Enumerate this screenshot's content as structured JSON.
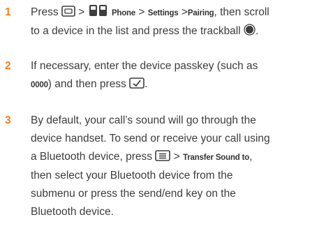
{
  "colors": {
    "step_number": "#f58220",
    "body_text": "#3d3d3d"
  },
  "icons": {
    "menu_key": "menu-key-icon",
    "phone_handset": "phone-handset-icon",
    "trackball": "trackball-icon",
    "soft_key": "soft-key-icon",
    "options_key": "options-key-icon"
  },
  "steps": [
    {
      "number": "1",
      "l1_press": "Press",
      "l1_sep1": ">",
      "l1_phone": "Phone",
      "l1_sep2": ">",
      "l1_settings": "Settings",
      "l1_sep3": ">",
      "l1_pairing": "Pairing",
      "l1_tail": ", then scroll",
      "l2_text": "to a device in the list and press the trackball",
      "l2_end": "."
    },
    {
      "number": "2",
      "l1_text": "If necessary, enter the device passkey (such as",
      "l2_code": "0000",
      "l2_text": ") and then press",
      "l2_end": "."
    },
    {
      "number": "3",
      "l1": "By default, your call’s sound will go through the",
      "l2": "device handset. To send or receive your call using",
      "l3_pre": "a Bluetooth device, press",
      "l3_sep": ">",
      "l3_transfer": "Transfer Sound to",
      "l3_end": ",",
      "l4": "then select your Bluetooth device from the",
      "l5": "submenu or press the send/end key on the",
      "l6": "Bluetooth device."
    }
  ]
}
